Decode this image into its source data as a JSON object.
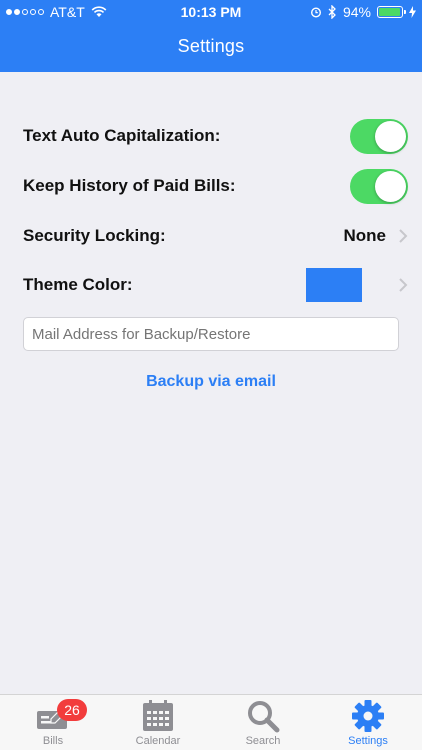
{
  "status": {
    "carrier": "AT&T",
    "time": "10:13 PM",
    "battery": "94%",
    "battery_level": 0.94
  },
  "header": {
    "title": "Settings"
  },
  "settings": {
    "auto_cap": {
      "label": "Text Auto Capitalization:",
      "on": true
    },
    "keep_history": {
      "label": "Keep History of Paid Bills:",
      "on": true
    },
    "security": {
      "label": "Security Locking:",
      "value": "None"
    },
    "theme": {
      "label": "Theme Color:",
      "color": "#2c7ff5"
    },
    "mail": {
      "placeholder": "Mail Address for Backup/Restore",
      "value": ""
    },
    "backup_label": "Backup via email"
  },
  "tabbar": {
    "tabs": [
      {
        "label": "Bills",
        "icon": "bills-icon",
        "badge": "26",
        "active": false
      },
      {
        "label": "Calendar",
        "icon": "calendar-icon",
        "active": false
      },
      {
        "label": "Search",
        "icon": "search-icon",
        "active": false
      },
      {
        "label": "Settings",
        "icon": "gear-icon",
        "active": true
      }
    ]
  },
  "colors": {
    "accent": "#2c7ff5",
    "toggle_on": "#4cd964",
    "badge": "#f23c3c"
  }
}
